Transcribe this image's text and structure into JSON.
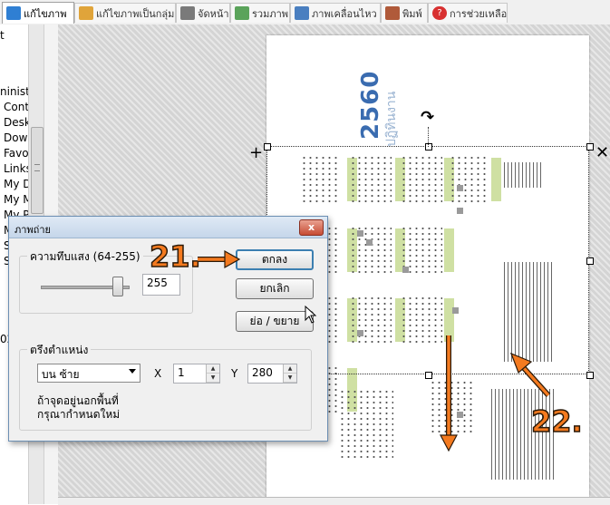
{
  "tabs": [
    {
      "label": "แก้ไขภาพ",
      "color": "#2f7fd3",
      "active": true
    },
    {
      "label": "แก้ไขภาพเป็นกลุ่ม",
      "color": "#e0a43a",
      "active": false
    },
    {
      "label": "จัดหน้า",
      "color": "#7a7a7a",
      "active": false
    },
    {
      "label": "รวมภาพ",
      "color": "#5aa35a",
      "active": false
    },
    {
      "label": "ภาพเคลื่อนไหว",
      "color": "#4a7fc0",
      "active": false
    },
    {
      "label": "พิมพ์",
      "color": "#b05a3a",
      "active": false
    },
    {
      "label": "การช่วยเหลือ",
      "color": "#d83030",
      "active": false
    }
  ],
  "tree": {
    "items": [
      "t",
      "ninist",
      "Cont",
      "Desk",
      "Dow",
      "Favo",
      "Links",
      "My D",
      "My M",
      "My P",
      "M",
      "S",
      "S",
      "02"
    ]
  },
  "page": {
    "year": "2560",
    "year_sub": "ปฏิทินงาน"
  },
  "dialog": {
    "title": "ภาพถ่าย",
    "close": "x",
    "opacity_group": "ความทึบแสง (64-255)",
    "opacity_value": "255",
    "opacity_level": 1.0,
    "ok": "ตกลง",
    "cancel": "ยกเลิก",
    "zoom": "ย่อ / ขยาย",
    "position_group": "ตรึงตำแหน่ง",
    "position_select": "บน ซ้าย",
    "x_label": "X",
    "x_value": "1",
    "y_label": "Y",
    "y_value": "280",
    "note_line1": "ถ้าจุดอยู่นอกพื้นที่",
    "note_line2": "กรุณากำหนดใหม่"
  },
  "annotations": {
    "step21": "21.",
    "step22": "22.",
    "accent": "#f47a1f"
  }
}
